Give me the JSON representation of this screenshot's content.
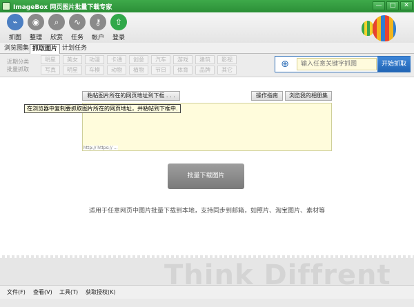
{
  "window": {
    "title": "ImageBox 网页图片批量下载专家",
    "buttons": {
      "minimize": "—",
      "maximize": "□",
      "close": "✕"
    }
  },
  "toolbar": {
    "items": [
      {
        "label": "抓图",
        "icon": "capture-icon",
        "glyph": "⌁"
      },
      {
        "label": "整理",
        "icon": "organize-icon",
        "glyph": "◉"
      },
      {
        "label": "欣赏",
        "icon": "search-icon",
        "glyph": "⌕"
      },
      {
        "label": "任务",
        "icon": "task-wave-icon",
        "glyph": "∿"
      },
      {
        "label": "帐户",
        "icon": "key-icon",
        "glyph": "⚷"
      },
      {
        "label": "登录",
        "icon": "cloud-upload-icon",
        "glyph": "⇧"
      }
    ]
  },
  "tabs": [
    {
      "label": "浏览图集"
    },
    {
      "label": "抓取图片"
    },
    {
      "label": "计划任务"
    }
  ],
  "categories": {
    "labels": [
      "近期分类",
      "批量抓取"
    ],
    "row1": [
      "明星",
      "美女",
      "动漫",
      "卡通",
      "创意",
      "汽车",
      "游戏",
      "建筑",
      "影视"
    ],
    "row2": [
      "写真",
      "明星",
      "车模",
      "动物",
      "植物",
      "节日",
      "体育",
      "品牌",
      "其它"
    ]
  },
  "search": {
    "placeholder": "输入任意关键字抓图",
    "button": "开始抓取",
    "icon": "globe-icon"
  },
  "main": {
    "paste_button": "粘帖图片所在的网页地址到下框 . . .",
    "guide_button": "操作指南",
    "album_button": "浏览我的相册集",
    "tooltip": "在浏览器中复制要抓取图片所在的网页地址，并粘帖到下框中.",
    "url_hint": "http:// https:// ...",
    "download_button": "批量下载图片",
    "description": "适用于任意网页中图片批量下载到本地，支持同步到邮箱，如照片、淘宝图片、素材等"
  },
  "watermark": "Think Diffrent",
  "menu": [
    {
      "label": "文件(F)"
    },
    {
      "label": "查看(V)"
    },
    {
      "label": "工具(T)"
    },
    {
      "label": "获取授权(K)"
    }
  ],
  "colors": {
    "title_green": "#2b8f37",
    "accent_blue": "#2f6fb8",
    "input_yellow": "#fffcdc"
  }
}
